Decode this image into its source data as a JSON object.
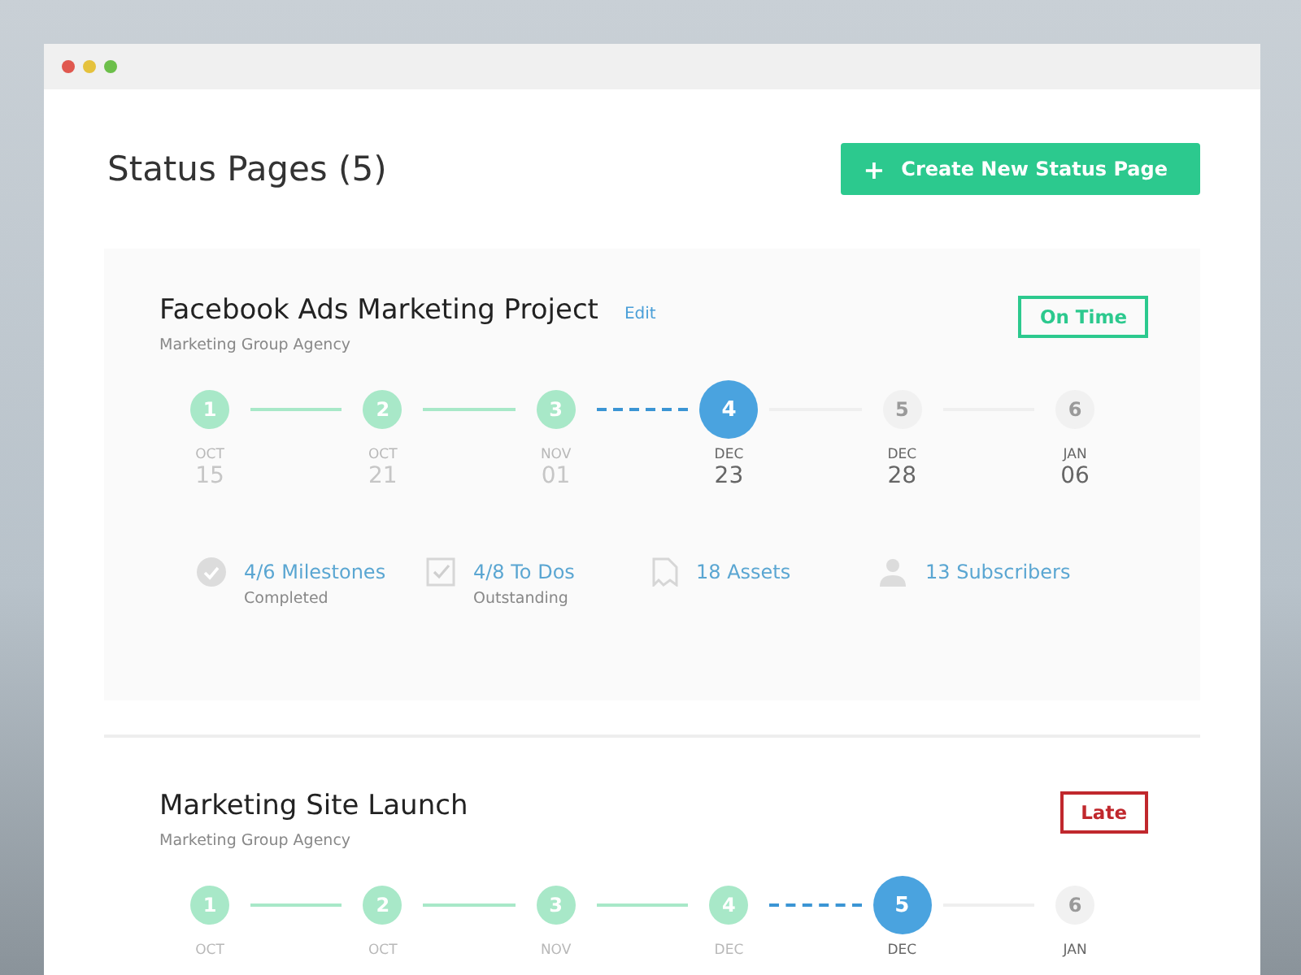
{
  "page": {
    "title": "Status Pages (5)",
    "create_button": {
      "icon": "+",
      "label": "Create New Status Page"
    }
  },
  "projects": [
    {
      "name": "Facebook Ads Marketing Project",
      "edit_link": "Edit",
      "agency": "Marketing Group Agency",
      "highlighted": true,
      "status": {
        "label": "On Time",
        "kind": "on_time"
      },
      "milestones": [
        {
          "number": "1",
          "month": "OCT",
          "day": "15",
          "done": true,
          "current": false
        },
        {
          "number": "2",
          "month": "OCT",
          "day": "21",
          "done": true,
          "current": false
        },
        {
          "number": "3",
          "month": "NOV",
          "day": "01",
          "done": true,
          "current": false
        },
        {
          "number": "4",
          "month": "DEC",
          "day": "23",
          "done": false,
          "current": true
        },
        {
          "number": "5",
          "month": "DEC",
          "day": "28",
          "done": false,
          "current": false
        },
        {
          "number": "6",
          "month": "JAN",
          "day": "06",
          "done": false,
          "current": false
        }
      ],
      "stats": [
        {
          "kind": "milestones",
          "value": "4/6 Milestones",
          "caption": "Completed"
        },
        {
          "kind": "todos",
          "value": "4/8 To Dos",
          "caption": "Outstanding"
        },
        {
          "kind": "assets",
          "value": "18 Assets"
        },
        {
          "kind": "subscribers",
          "value": "13 Subscribers"
        }
      ]
    },
    {
      "name": "Marketing Site Launch",
      "agency": "Marketing Group Agency",
      "highlighted": false,
      "status": {
        "label": "Late",
        "kind": "late"
      },
      "milestones": [
        {
          "number": "1",
          "month": "OCT",
          "done": true,
          "current": false
        },
        {
          "number": "2",
          "month": "OCT",
          "done": true,
          "current": false
        },
        {
          "number": "3",
          "month": "NOV",
          "done": true,
          "current": false
        },
        {
          "number": "4",
          "month": "DEC",
          "done": true,
          "current": false
        },
        {
          "number": "5",
          "month": "DEC",
          "done": false,
          "current": true
        },
        {
          "number": "6",
          "month": "JAN",
          "done": false,
          "current": false
        }
      ]
    }
  ]
}
